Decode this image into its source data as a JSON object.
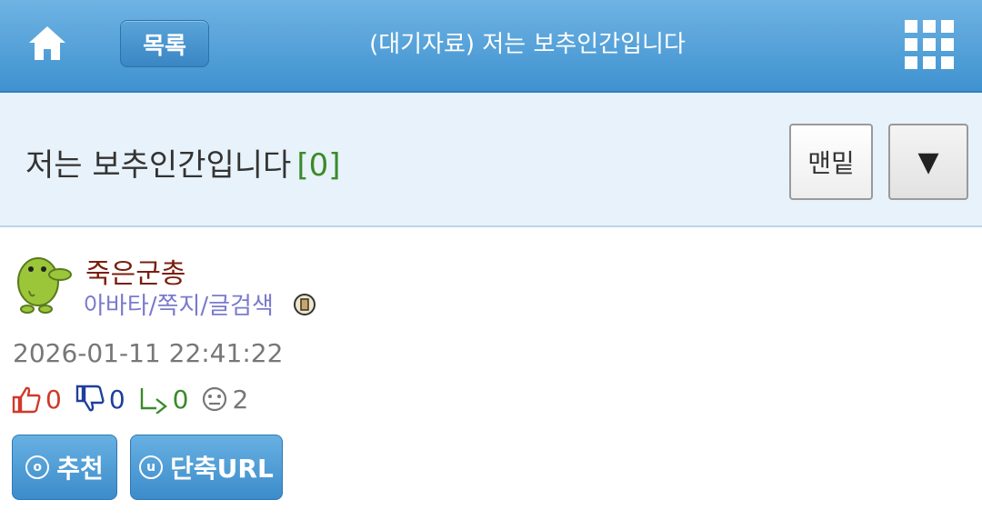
{
  "header": {
    "list_label": "목록",
    "title": "(대기자료) 저는 보추인간입니다"
  },
  "post": {
    "subject": "저는 보추인간입니다",
    "comment_count": "[0]",
    "bottom_label": "맨밑",
    "down_arrow": "▼"
  },
  "author": {
    "name": "죽은군총",
    "links": "아바타/쪽지/글검색"
  },
  "meta": {
    "datetime": "2026-01-11 22:41:22",
    "upvotes": "0",
    "downvotes": "0",
    "shares": "0",
    "views": "2"
  },
  "actions": {
    "recommend_icon": "o",
    "recommend_label": "추천",
    "shorturl_icon": "u",
    "shorturl_label": "단축URL"
  },
  "colors": {
    "header_blue": "#3f92d0",
    "subbar_bg": "#e8f2fa",
    "author_color": "#7a1e0e",
    "link_color": "#7a7acc",
    "up_color": "#d0392a",
    "down_color": "#1f3f9c",
    "share_color": "#3a8a2a"
  }
}
